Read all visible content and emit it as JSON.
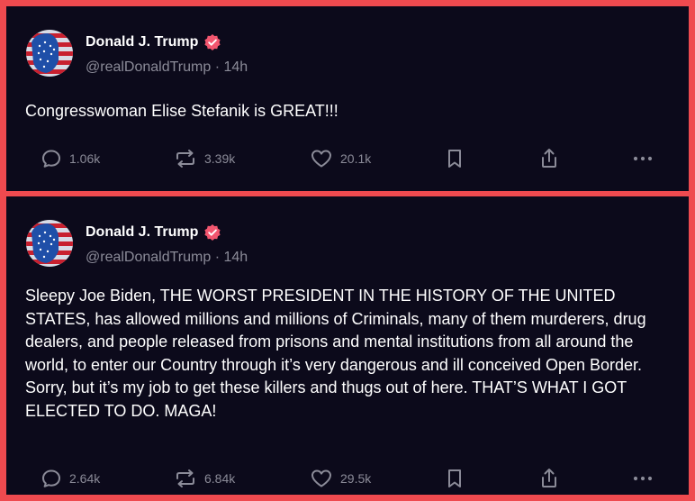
{
  "posts": [
    {
      "author": {
        "name": "Donald J. Trump",
        "handle": "@realDonaldTrump",
        "time": "14h",
        "verified_color": "#f2566f"
      },
      "text": "Congresswoman Elise Stefanik is GREAT!!!",
      "stats": {
        "replies": "1.06k",
        "reposts": "3.39k",
        "likes": "20.1k"
      },
      "icons": [
        "reply-icon",
        "repost-icon",
        "like-icon",
        "bookmark-icon",
        "share-icon",
        "more-icon"
      ]
    },
    {
      "author": {
        "name": "Donald J. Trump",
        "handle": "@realDonaldTrump",
        "time": "14h",
        "verified_color": "#f2566f"
      },
      "text": "Sleepy Joe Biden, THE WORST PRESIDENT IN THE HISTORY OF THE UNITED STATES, has allowed millions and millions of Criminals, many of them murderers, drug dealers, and people released from prisons and mental institutions from all around the world, to enter our Country through it’s very dangerous and ill conceived Open Border. Sorry, but it’s my job to get these killers and thugs out of here. THAT’S WHAT I GOT ELECTED TO DO. MAGA!",
      "stats": {
        "replies": "2.64k",
        "reposts": "6.84k",
        "likes": "29.5k"
      },
      "icons": [
        "reply-icon",
        "repost-icon",
        "like-icon",
        "bookmark-icon",
        "share-icon",
        "more-icon"
      ]
    }
  ],
  "colors": {
    "border": "#ef4a4f",
    "background": "#0c0a1b",
    "text": "#ffffff",
    "muted": "#8b8b98"
  }
}
